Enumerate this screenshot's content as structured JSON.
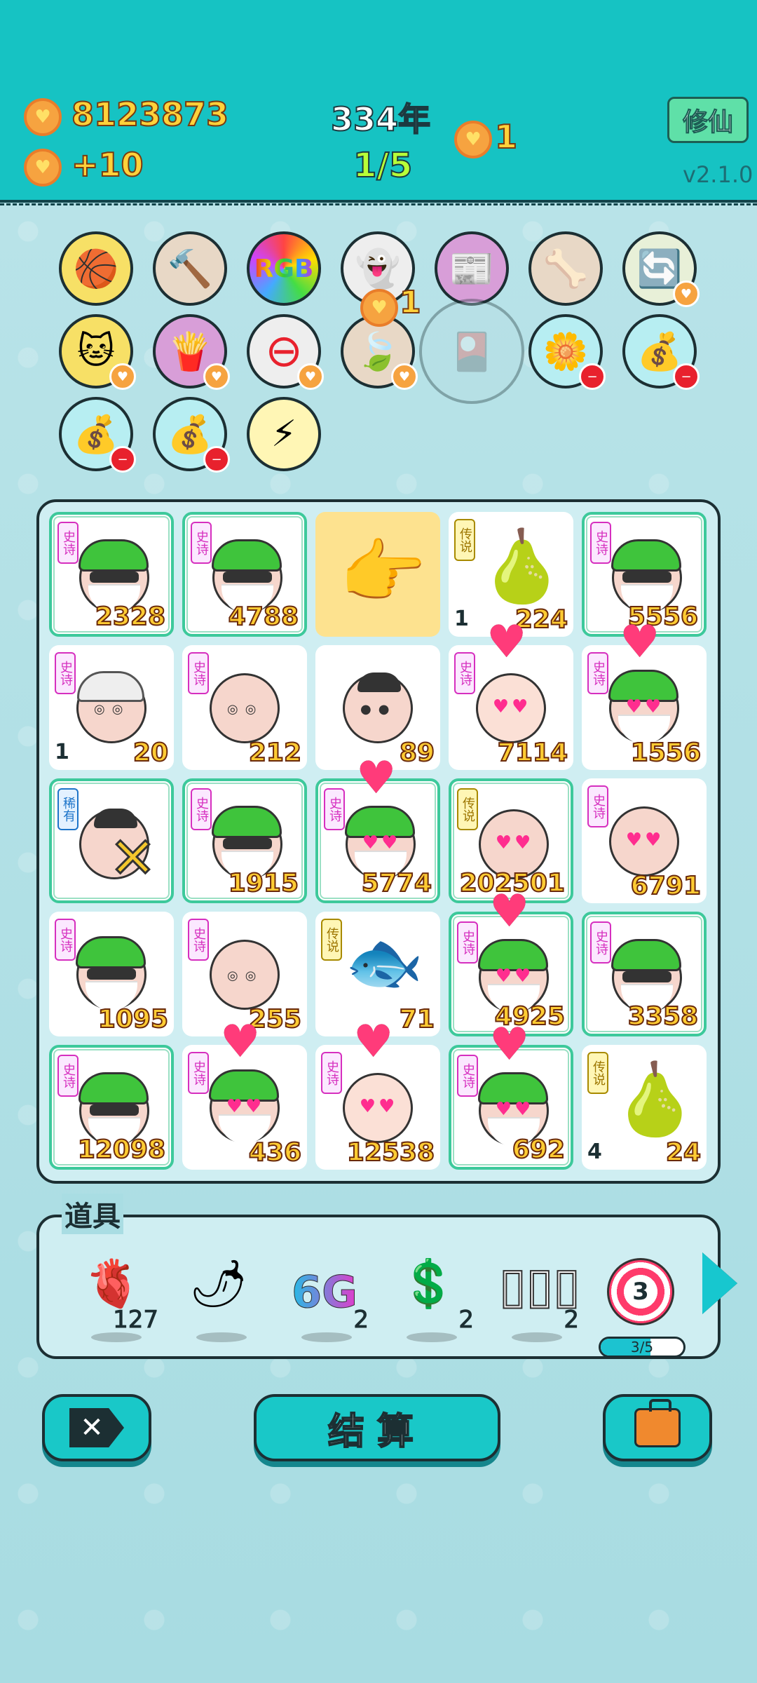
{
  "header": {
    "gold": "8123873",
    "income": "+10",
    "year": "334年",
    "round": "1/5",
    "side_coin": "1",
    "rebirth_label": "修仙",
    "version": "v2.1.0"
  },
  "relics": [
    {
      "name": "basketballs-icon",
      "emoji": "🏀",
      "bg": "#f7e066",
      "badge": ""
    },
    {
      "name": "hammer-icon",
      "emoji": "🔨",
      "bg": "#e8d8c6",
      "badge": ""
    },
    {
      "name": "rgb-icon",
      "emoji": "RGB",
      "bg": "#ffffff",
      "badge": ""
    },
    {
      "name": "ghost-icon",
      "emoji": "👻",
      "bg": "#eeeeee",
      "badge": ""
    },
    {
      "name": "time-magazine-icon",
      "emoji": "📰",
      "bg": "#d89ed8",
      "badge": ""
    },
    {
      "name": "pet-food-icon",
      "emoji": "🦴",
      "bg": "#e8d8c6",
      "badge": ""
    },
    {
      "name": "refresh-icon",
      "emoji": "🔄",
      "bg": "#e8f0d8",
      "badge": "heart"
    },
    {
      "name": "cat-icon",
      "emoji": "🐱",
      "bg": "#f7e066",
      "badge": "heart"
    },
    {
      "name": "fries-icon",
      "emoji": "🍟",
      "bg": "#d89ed8",
      "badge": "heart"
    },
    {
      "name": "minus-sign-icon",
      "emoji": "⊖",
      "bg": "#eeeeee",
      "badge": "heart"
    },
    {
      "name": "leaf-icon",
      "emoji": "🍃",
      "bg": "#e8d8c6",
      "badge": "heart"
    },
    {
      "name": "card-pack-icon",
      "emoji": "🎴",
      "bg": "#b7dde3",
      "badge": ""
    },
    {
      "name": "flower-pot-icon",
      "emoji": "🌼",
      "bg": "#b7eef2",
      "badge": "minus"
    },
    {
      "name": "money-bag-icon",
      "emoji": "💰",
      "bg": "#b7eef2",
      "badge": "minus"
    },
    {
      "name": "money-bag-icon",
      "emoji": "💰",
      "bg": "#b7eef2",
      "badge": "minus"
    },
    {
      "name": "money-bag-icon",
      "emoji": "💰",
      "bg": "#b7eef2",
      "badge": "minus"
    },
    {
      "name": "lightning-icon",
      "emoji": "⚡",
      "bg": "#fff6b5",
      "badge": ""
    }
  ],
  "relic_coin_popup": "1",
  "grid": [
    {
      "kind": "green",
      "tag": "史诗",
      "value": "2328",
      "count": "",
      "framed": true
    },
    {
      "kind": "green",
      "tag": "史诗",
      "value": "4788",
      "count": "",
      "framed": true
    },
    {
      "kind": "hand",
      "tag": "",
      "value": "",
      "count": "",
      "framed": false
    },
    {
      "kind": "pear",
      "tag": "传说",
      "value": "224",
      "count": "1",
      "framed": false
    },
    {
      "kind": "green",
      "tag": "史诗",
      "value": "5556",
      "count": "",
      "framed": true
    },
    {
      "kind": "whitehair",
      "tag": "史诗",
      "value": "20",
      "count": "1",
      "framed": false
    },
    {
      "kind": "bald",
      "tag": "史诗",
      "value": "212",
      "count": "",
      "framed": false
    },
    {
      "kind": "darkhair",
      "tag": "",
      "value": "89",
      "count": "",
      "framed": false
    },
    {
      "kind": "girl",
      "tag": "史诗",
      "value": "7114",
      "count": "",
      "framed": false
    },
    {
      "kind": "greenheart",
      "tag": "史诗",
      "value": "1556",
      "count": "",
      "framed": false
    },
    {
      "kind": "xface",
      "tag": "稀有",
      "value": "",
      "count": "",
      "framed": true
    },
    {
      "kind": "green",
      "tag": "史诗",
      "value": "1915",
      "count": "",
      "framed": true
    },
    {
      "kind": "greenheart",
      "tag": "史诗",
      "value": "5774",
      "count": "",
      "framed": true
    },
    {
      "kind": "baldheart",
      "tag": "传说",
      "value": "202501",
      "count": "",
      "framed": true
    },
    {
      "kind": "baldheart",
      "tag": "史诗",
      "value": "6791",
      "count": "",
      "framed": false
    },
    {
      "kind": "green",
      "tag": "史诗",
      "value": "1095",
      "count": "",
      "framed": false
    },
    {
      "kind": "bald",
      "tag": "史诗",
      "value": "255",
      "count": "",
      "framed": false
    },
    {
      "kind": "fish",
      "tag": "传说",
      "value": "71",
      "count": "",
      "framed": false
    },
    {
      "kind": "greenheart",
      "tag": "史诗",
      "value": "4925",
      "count": "",
      "framed": true
    },
    {
      "kind": "green",
      "tag": "史诗",
      "value": "3358",
      "count": "",
      "framed": true
    },
    {
      "kind": "green",
      "tag": "史诗",
      "value": "12098",
      "count": "",
      "framed": true
    },
    {
      "kind": "greenheart",
      "tag": "史诗",
      "value": "436",
      "count": "",
      "framed": false
    },
    {
      "kind": "girl",
      "tag": "史诗",
      "value": "12538",
      "count": "",
      "framed": false
    },
    {
      "kind": "greenheart",
      "tag": "史诗",
      "value": "692",
      "count": "",
      "framed": true
    },
    {
      "kind": "pear",
      "tag": "传说",
      "value": "24",
      "count": "4",
      "framed": false
    }
  ],
  "props": {
    "title": "道具",
    "items": [
      {
        "name": "liver-icon",
        "icon": "🫀",
        "value": "127"
      },
      {
        "name": "chili-icon",
        "icon": "🌶",
        "value": ""
      },
      {
        "name": "sixg-icon",
        "icon": "6G",
        "value": "2"
      },
      {
        "name": "dollar-coin-icon",
        "icon": "💲",
        "value": "2"
      },
      {
        "name": "tubes-icon",
        "icon": "▯▯▯",
        "value": "2"
      },
      {
        "name": "target-icon",
        "icon": "3",
        "value": ""
      }
    ],
    "target_progress_label": "3/5",
    "target_progress": 0.6
  },
  "buttons": {
    "settle_label": "结算"
  }
}
